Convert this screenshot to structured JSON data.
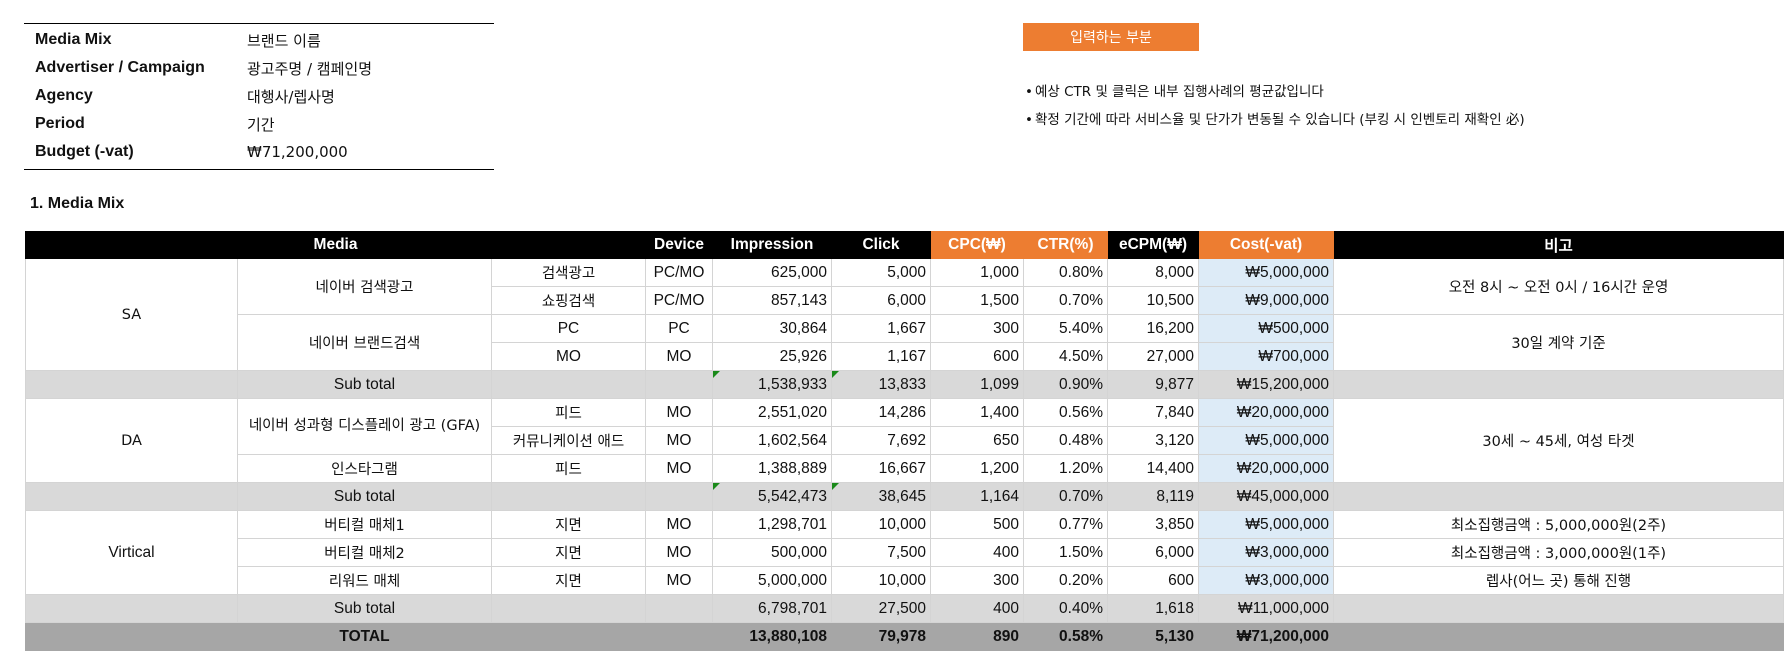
{
  "info": {
    "rows": [
      {
        "key": "Media Mix",
        "value": "브랜드 이름"
      },
      {
        "key": "Advertiser / Campaign",
        "value": "광고주명 / 캠페인명"
      },
      {
        "key": "Agency",
        "value": "대행사/렙사명"
      },
      {
        "key": "Period",
        "value": "기간"
      },
      {
        "key": "Budget (-vat)",
        "value": "₩71,200,000"
      }
    ]
  },
  "tag_label": "입력하는 부분",
  "notes": [
    "예상 CTR 및 클릭은 내부 집행사례의 평균값입니다",
    "확정 기간에 따라 서비스율 및 단가가 변동될 수 있습니다 (부킹 시 인벤토리 재확인 必)"
  ],
  "note_bullet": "•",
  "section_title": "1. Media Mix",
  "table": {
    "headers": {
      "media": "Media",
      "device": "Device",
      "impression": "Impression",
      "click": "Click",
      "cpc": "CPC(₩)",
      "ctr": "CTR(%)",
      "ecpm": "eCPM(₩)",
      "cost": "Cost(-vat)",
      "note": "비고"
    },
    "groups": {
      "sa": "SA",
      "da": "DA",
      "vertical": "Virtical"
    },
    "media": {
      "naver_search": "네이버 검색광고",
      "naver_brand": "네이버 브랜드검색",
      "gfa": "네이버 성과형 디스플레이 광고 (GFA)",
      "instagram": "인스타그램",
      "vertical1": "버티컬 매체1",
      "vertical2": "버티컬 매체2",
      "reward": "리워드 매체"
    },
    "remarks": {
      "sa_search": "오전 8시 ~ 오전 0시 / 16시간 운영",
      "sa_brand": "30일 계약 기준",
      "da": "30세 ~ 45세, 여성 타겟",
      "v1": "최소집행금액 : 5,000,000원(2주)",
      "v2": "최소집행금액 : 3,000,000원(1주)",
      "v3": "렙사(어느 곳) 통해 진행"
    },
    "rows": {
      "r1": {
        "type": "검색광고",
        "device": "PC/MO",
        "impression": "625,000",
        "click": "5,000",
        "cpc": "1,000",
        "ctr": "0.80%",
        "ecpm": "8,000",
        "cost": "₩5,000,000"
      },
      "r2": {
        "type": "쇼핑검색",
        "device": "PC/MO",
        "impression": "857,143",
        "click": "6,000",
        "cpc": "1,500",
        "ctr": "0.70%",
        "ecpm": "10,500",
        "cost": "₩9,000,000"
      },
      "r3": {
        "type": "PC",
        "device": "PC",
        "impression": "30,864",
        "click": "1,667",
        "cpc": "300",
        "ctr": "5.40%",
        "ecpm": "16,200",
        "cost": "₩500,000"
      },
      "r4": {
        "type": "MO",
        "device": "MO",
        "impression": "25,926",
        "click": "1,167",
        "cpc": "600",
        "ctr": "4.50%",
        "ecpm": "27,000",
        "cost": "₩700,000"
      },
      "s1": {
        "label": "Sub total",
        "impression": "1,538,933",
        "click": "13,833",
        "cpc": "1,099",
        "ctr": "0.90%",
        "ecpm": "9,877",
        "cost": "₩15,200,000"
      },
      "r5": {
        "type": "피드",
        "device": "MO",
        "impression": "2,551,020",
        "click": "14,286",
        "cpc": "1,400",
        "ctr": "0.56%",
        "ecpm": "7,840",
        "cost": "₩20,000,000"
      },
      "r6": {
        "type": "커뮤니케이션 애드",
        "device": "MO",
        "impression": "1,602,564",
        "click": "7,692",
        "cpc": "650",
        "ctr": "0.48%",
        "ecpm": "3,120",
        "cost": "₩5,000,000"
      },
      "r7": {
        "type": "피드",
        "device": "MO",
        "impression": "1,388,889",
        "click": "16,667",
        "cpc": "1,200",
        "ctr": "1.20%",
        "ecpm": "14,400",
        "cost": "₩20,000,000"
      },
      "s2": {
        "label": "Sub total",
        "impression": "5,542,473",
        "click": "38,645",
        "cpc": "1,164",
        "ctr": "0.70%",
        "ecpm": "8,119",
        "cost": "₩45,000,000"
      },
      "r8": {
        "type": "지면",
        "device": "MO",
        "impression": "1,298,701",
        "click": "10,000",
        "cpc": "500",
        "ctr": "0.77%",
        "ecpm": "3,850",
        "cost": "₩5,000,000"
      },
      "r9": {
        "type": "지면",
        "device": "MO",
        "impression": "500,000",
        "click": "7,500",
        "cpc": "400",
        "ctr": "1.50%",
        "ecpm": "6,000",
        "cost": "₩3,000,000"
      },
      "r10": {
        "type": "지면",
        "device": "MO",
        "impression": "5,000,000",
        "click": "10,000",
        "cpc": "300",
        "ctr": "0.20%",
        "ecpm": "600",
        "cost": "₩3,000,000"
      },
      "s3": {
        "label": "Sub total",
        "impression": "6,798,701",
        "click": "27,500",
        "cpc": "400",
        "ctr": "0.40%",
        "ecpm": "1,618",
        "cost": "₩11,000,000"
      },
      "total": {
        "label": "TOTAL",
        "impression": "13,880,108",
        "click": "79,978",
        "cpc": "890",
        "ctr": "0.58%",
        "ecpm": "5,130",
        "cost": "₩71,200,000"
      }
    }
  }
}
